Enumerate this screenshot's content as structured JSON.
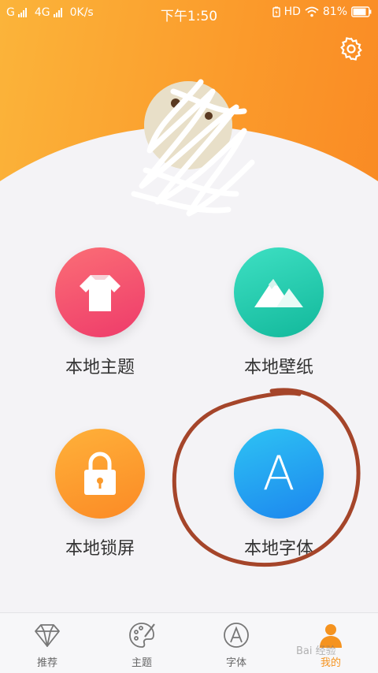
{
  "status_bar": {
    "carrier1": "G",
    "carrier2": "4G",
    "speed": "0K/s",
    "time": "下午1:50",
    "hd": "HD",
    "battery": "81%"
  },
  "menu": [
    {
      "label": "本地主题",
      "icon": "tshirt-icon",
      "color": "#f2476c"
    },
    {
      "label": "本地壁纸",
      "icon": "mountain-icon",
      "color": "#1ec9a9"
    },
    {
      "label": "本地锁屏",
      "icon": "lock-icon",
      "color": "#fb9a2b"
    },
    {
      "label": "本地字体",
      "icon": "letter-a-icon",
      "color": "#229ff0"
    }
  ],
  "font_icon_letter": "A",
  "tabs": [
    {
      "label": "推荐",
      "icon": "diamond-icon",
      "active": false
    },
    {
      "label": "主题",
      "icon": "palette-icon",
      "active": false
    },
    {
      "label": "字体",
      "icon": "font-icon",
      "active": false
    },
    {
      "label": "我的",
      "icon": "person-icon",
      "active": true
    }
  ],
  "watermark": "Bai 经验",
  "colors": {
    "header_orange": "#fb9a2b",
    "active_tab": "#f5931f",
    "annotation_circle": "#a5452a"
  }
}
